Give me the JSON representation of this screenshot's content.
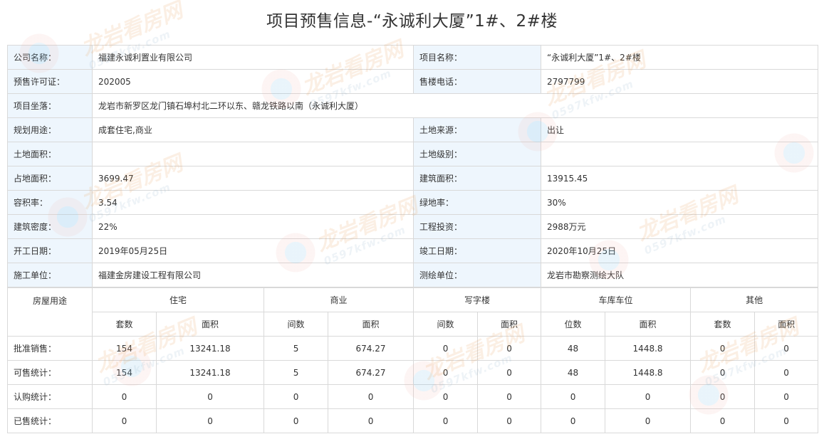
{
  "title": "项目预售信息-“永诚利大厦”1#、2#楼",
  "info_rows": [
    {
      "l1": "公司名称：",
      "v1": "福建永诚利置业有限公司",
      "l2": "项目名称：",
      "v2": "“永诚利大厦”1#、2#楼"
    },
    {
      "l1": "预售许可证：",
      "v1": "202005",
      "l2": "售楼电话：",
      "v2": "2797799"
    },
    {
      "l1": "项目坐落：",
      "v1": "龙岩市新罗区龙门镇石埠村北二环以东、赣龙铁路以南（永诚利大厦）"
    },
    {
      "l1": "规划用途：",
      "v1": "成套住宅,商业",
      "l2": "土地来源：",
      "v2": "出让"
    },
    {
      "l1": "土地面积：",
      "v1": "",
      "l2": "土地级别：",
      "v2": ""
    },
    {
      "l1": "占地面积：",
      "v1": "3699.47",
      "l2": "建筑面积：",
      "v2": "13915.45"
    },
    {
      "l1": "容积率：",
      "v1": "3.54",
      "l2": "绿地率：",
      "v2": "30%"
    },
    {
      "l1": "建筑密度：",
      "v1": "22%",
      "l2": "工程投资：",
      "v2": "2988万元"
    },
    {
      "l1": "开工日期：",
      "v1": "2019年05月25日",
      "l2": "竣工日期：",
      "v2": "2020年10月25日"
    },
    {
      "l1": "施工单位：",
      "v1": "福建金房建设工程有限公司",
      "l2": "测绘单位：",
      "v2": "龙岩市勘察测绘大队"
    }
  ],
  "usage_table": {
    "corner": "房屋用途",
    "groups": [
      "住宅",
      "商业",
      "写字楼",
      "车库车位",
      "其他"
    ],
    "subheaders": [
      "套数",
      "面积",
      "间数",
      "面积",
      "间数",
      "面积",
      "位数",
      "面积",
      "套数",
      "面积"
    ],
    "rows": [
      {
        "label": "批准销售：",
        "values": [
          "154",
          "13241.18",
          "5",
          "674.27",
          "0",
          "0",
          "48",
          "1448.8",
          "0",
          "0"
        ]
      },
      {
        "label": "可售统计：",
        "values": [
          "154",
          "13241.18",
          "5",
          "674.27",
          "0",
          "0",
          "48",
          "1448.8",
          "0",
          "0"
        ]
      },
      {
        "label": "认购统计：",
        "values": [
          "0",
          "0",
          "0",
          "0",
          "0",
          "0",
          "0",
          "0",
          "0",
          "0"
        ]
      },
      {
        "label": "已售统计：",
        "values": [
          "0",
          "0",
          "0",
          "0",
          "0",
          "0",
          "0",
          "0",
          "0",
          "0"
        ]
      }
    ]
  },
  "watermark": {
    "name": "龙岩看房网",
    "url": "0597kfw.com"
  }
}
